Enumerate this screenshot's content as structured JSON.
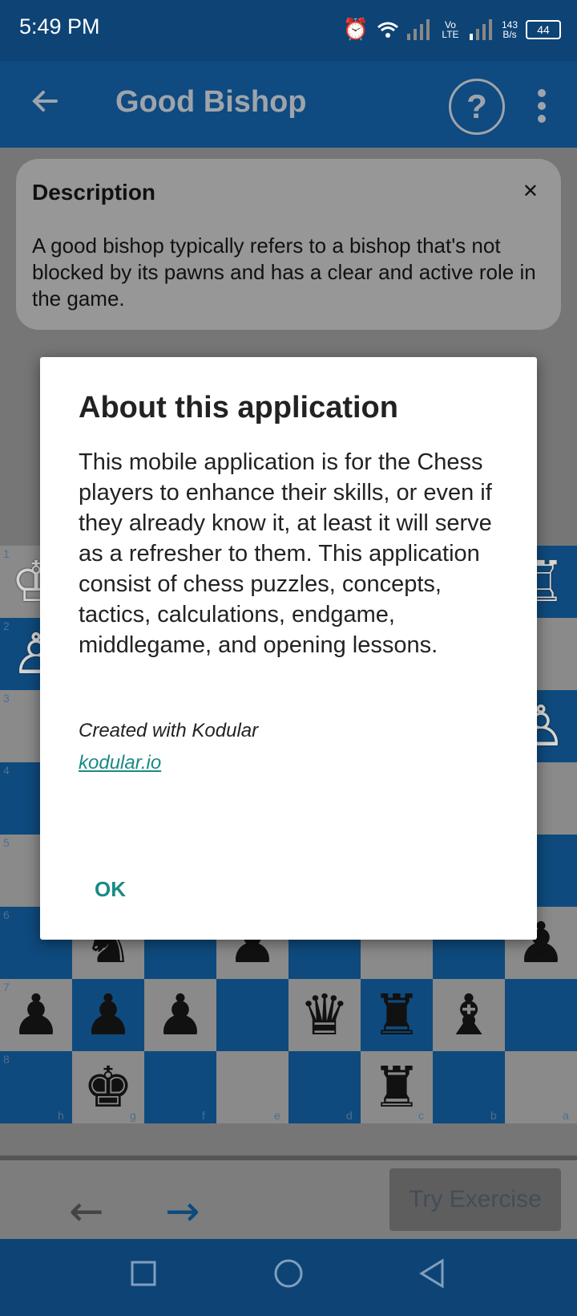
{
  "status": {
    "time": "5:49 PM",
    "net_speed_top": "143",
    "net_speed_bottom": "B/s",
    "network": "Vo LTE",
    "battery": "44"
  },
  "appbar": {
    "title": "Good Bishop"
  },
  "description": {
    "title": "Description",
    "text": "A good bishop typically refers to a bishop that's not blocked by its pawns and has a clear and active role in the game."
  },
  "board": {
    "ranks": [
      "1",
      "2",
      "3",
      "4",
      "5",
      "6",
      "7",
      "8"
    ],
    "files": [
      "h",
      "g",
      "f",
      "e",
      "d",
      "c",
      "b",
      "a"
    ]
  },
  "bottom": {
    "try_label": "Try Exercise"
  },
  "dialog": {
    "title": "About this application",
    "body": "This mobile application is for the Chess players to enhance their skills, or even if they already know it, at least it will serve as a refresher to them. This application consist of chess puzzles, concepts, tactics, calculations, endgame, middlegame, and opening lessons.",
    "created": "Created with Kodular",
    "link": "kodular.io",
    "ok": "OK"
  }
}
